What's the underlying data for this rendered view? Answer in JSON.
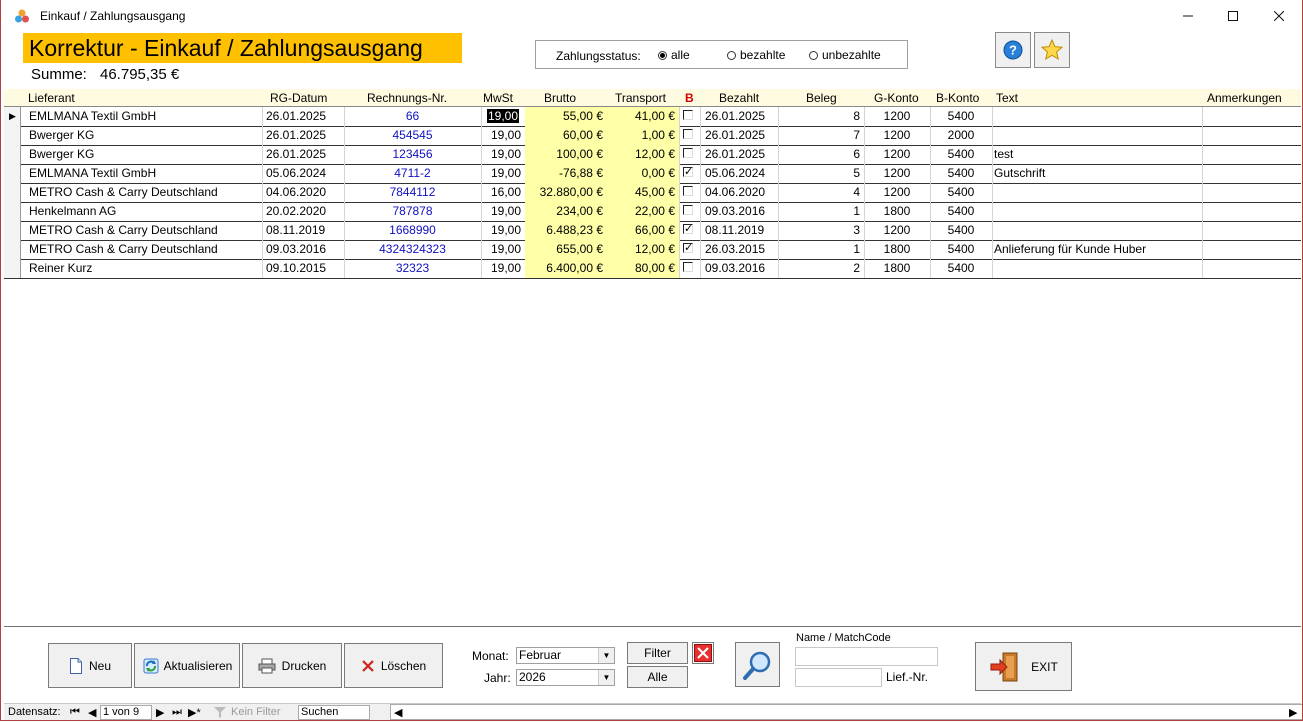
{
  "window": {
    "title": "Einkauf / Zahlungsausgang"
  },
  "header": {
    "title": "Korrektur - Einkauf / Zahlungsausgang",
    "summe_label": "Summe:",
    "summe_value": "46.795,35 €"
  },
  "status": {
    "label": "Zahlungsstatus:",
    "options": [
      "alle",
      "bezahlte",
      "unbezahlte"
    ],
    "selected": "alle"
  },
  "columns": [
    "Lieferant",
    "RG-Datum",
    "Rechnungs-Nr.",
    "MwSt",
    "Brutto",
    "Transport",
    "B",
    "Bezahlt",
    "Beleg",
    "G-Konto",
    "B-Konto",
    "Text",
    "Anmerkungen"
  ],
  "rows": [
    {
      "lieferant": "EMLMANA Textil GmbH",
      "datum": "26.01.2025",
      "nr": "66",
      "mwst": "19,00",
      "brutto": "55,00 €",
      "transport": "41,00 €",
      "b": false,
      "bezahlt": "26.01.2025",
      "beleg": "8",
      "gkonto": "1200",
      "bkonto": "5400",
      "text": "",
      "anm": ""
    },
    {
      "lieferant": "Bwerger KG",
      "datum": "26.01.2025",
      "nr": "454545",
      "mwst": "19,00",
      "brutto": "60,00 €",
      "transport": "1,00 €",
      "b": false,
      "bezahlt": "26.01.2025",
      "beleg": "7",
      "gkonto": "1200",
      "bkonto": "2000",
      "text": "",
      "anm": ""
    },
    {
      "lieferant": "Bwerger KG",
      "datum": "26.01.2025",
      "nr": "123456",
      "mwst": "19,00",
      "brutto": "100,00 €",
      "transport": "12,00 €",
      "b": false,
      "bezahlt": "26.01.2025",
      "beleg": "6",
      "gkonto": "1200",
      "bkonto": "5400",
      "text": "test",
      "anm": ""
    },
    {
      "lieferant": "EMLMANA Textil GmbH",
      "datum": "05.06.2024",
      "nr": "4711-2",
      "mwst": "19,00",
      "brutto": "-76,88 €",
      "transport": "0,00 €",
      "b": true,
      "bezahlt": "05.06.2024",
      "beleg": "5",
      "gkonto": "1200",
      "bkonto": "5400",
      "text": "Gutschrift",
      "anm": ""
    },
    {
      "lieferant": "METRO Cash & Carry Deutschland",
      "datum": "04.06.2020",
      "nr": "7844112",
      "mwst": "16,00",
      "brutto": "32.880,00 €",
      "transport": "45,00 €",
      "b": false,
      "bezahlt": "04.06.2020",
      "beleg": "4",
      "gkonto": "1200",
      "bkonto": "5400",
      "text": "",
      "anm": ""
    },
    {
      "lieferant": "Henkelmann AG",
      "datum": "20.02.2020",
      "nr": "787878",
      "mwst": "19,00",
      "brutto": "234,00 €",
      "transport": "22,00 €",
      "b": false,
      "bezahlt": "09.03.2016",
      "beleg": "1",
      "gkonto": "1800",
      "bkonto": "5400",
      "text": "",
      "anm": ""
    },
    {
      "lieferant": "METRO Cash & Carry Deutschland",
      "datum": "08.11.2019",
      "nr": "1668990",
      "mwst": "19,00",
      "brutto": "6.488,23 €",
      "transport": "66,00 €",
      "b": true,
      "bezahlt": "08.11.2019",
      "beleg": "3",
      "gkonto": "1200",
      "bkonto": "5400",
      "text": "",
      "anm": ""
    },
    {
      "lieferant": "METRO Cash & Carry Deutschland",
      "datum": "09.03.2016",
      "nr": "4324324323",
      "mwst": "19,00",
      "brutto": "655,00 €",
      "transport": "12,00 €",
      "b": true,
      "bezahlt": "26.03.2015",
      "beleg": "1",
      "gkonto": "1800",
      "bkonto": "5400",
      "text": "Anlieferung für Kunde Huber",
      "anm": ""
    },
    {
      "lieferant": "Reiner Kurz",
      "datum": "09.10.2015",
      "nr": "32323",
      "mwst": "19,00",
      "brutto": "6.400,00 €",
      "transport": "80,00 €",
      "b": false,
      "bezahlt": "09.03.2016",
      "beleg": "2",
      "gkonto": "1800",
      "bkonto": "5400",
      "text": "",
      "anm": ""
    }
  ],
  "buttons": {
    "neu": "Neu",
    "aktualisieren": "Aktualisieren",
    "drucken": "Drucken",
    "loeschen": "Löschen",
    "filter": "Filter",
    "alle": "Alle",
    "exit": "EXIT"
  },
  "filters": {
    "monat_label": "Monat:",
    "monat_value": "Februar",
    "jahr_label": "Jahr:",
    "jahr_value": "2026",
    "name_label": "Name / MatchCode",
    "name_value": "",
    "lief_label": "Lief.-Nr.",
    "lief_value": ""
  },
  "nav": {
    "label": "Datensatz:",
    "position": "1 von 9",
    "filter": "Kein Filter",
    "search": "Suchen"
  }
}
